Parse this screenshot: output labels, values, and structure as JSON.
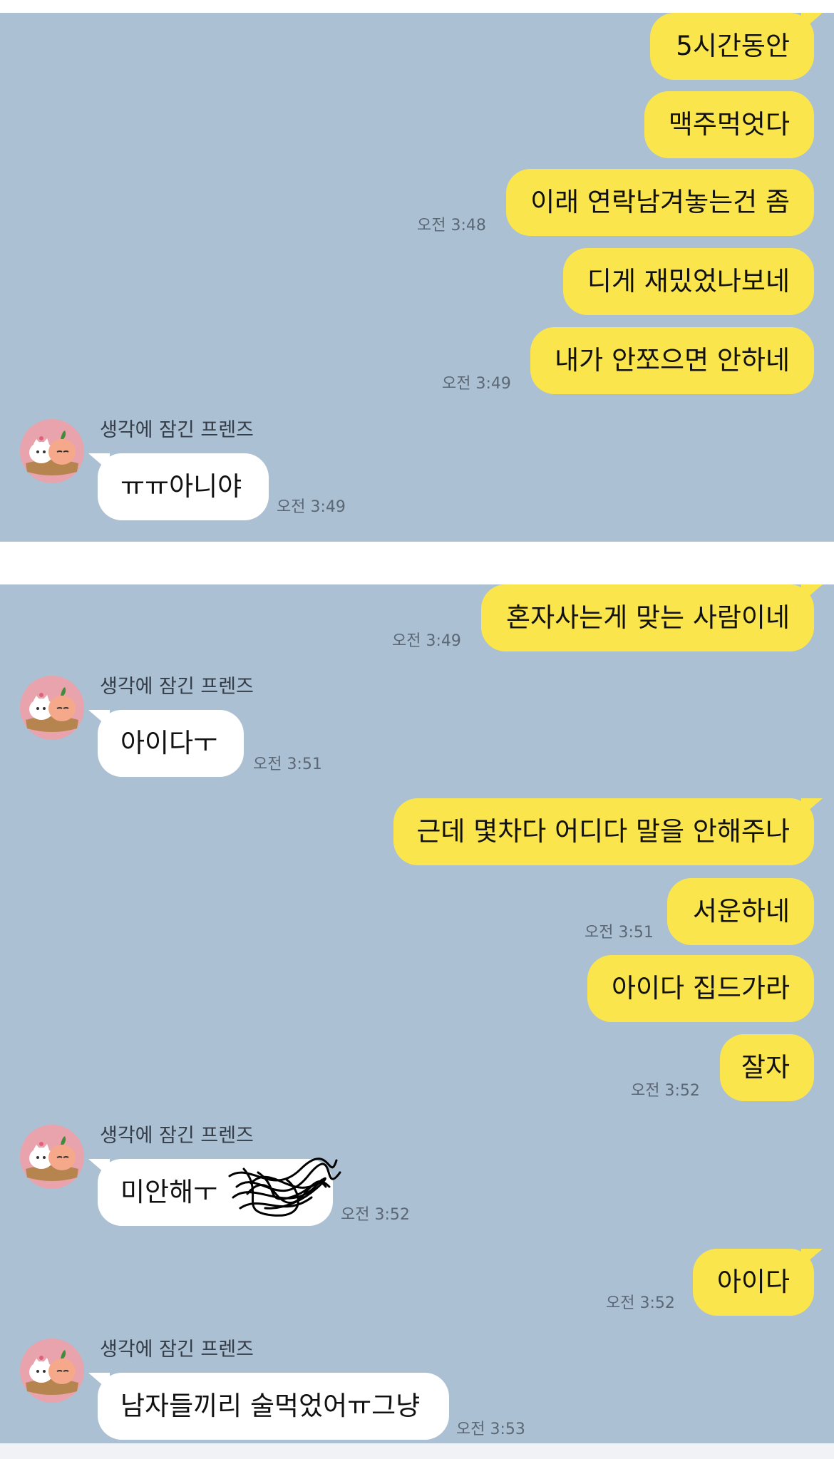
{
  "colors": {
    "background": "#abc0d2",
    "outgoing_bubble": "#fbe54d",
    "incoming_bubble": "#ffffff",
    "time_text": "#5b6775"
  },
  "contact": {
    "name": "생각에 잠긴 프렌즈",
    "avatar_icon": "friends-character-avatar-icon"
  },
  "screen1": {
    "messages": [
      {
        "from": "me",
        "text": "5시간동안"
      },
      {
        "from": "me",
        "text": "맥주먹엇다"
      },
      {
        "from": "me",
        "text": "이래 연락남겨놓는건 좀",
        "time": "오전 3:48"
      },
      {
        "from": "me",
        "text": "디게 재밌었나보네"
      },
      {
        "from": "me",
        "text": "내가 안쪼으면 안하네",
        "time": "오전 3:49"
      },
      {
        "from": "them",
        "sender": "생각에 잠긴 프렌즈",
        "text": "ㅠㅠ아니야",
        "time": "오전 3:49"
      }
    ]
  },
  "screen2": {
    "messages": [
      {
        "from": "me",
        "text": "혼자사는게 맞는 사람이네",
        "time": "오전 3:49"
      },
      {
        "from": "them",
        "sender": "생각에 잠긴 프렌즈",
        "text": "아이다ㅜ",
        "time": "오전 3:51"
      },
      {
        "from": "me",
        "text": "근데 몇차다 어디다 말을 안해주나"
      },
      {
        "from": "me",
        "text": "서운하네",
        "time": "오전 3:51"
      },
      {
        "from": "me",
        "text": "아이다 집드가라"
      },
      {
        "from": "me",
        "text": "잘자",
        "time": "오전 3:52"
      },
      {
        "from": "them",
        "sender": "생각에 잠긴 프렌즈",
        "text": "미안해ㅜ",
        "time": "오전 3:52",
        "redaction_icon": "scribble-redaction-icon"
      },
      {
        "from": "me",
        "text": "아이다",
        "time": "오전 3:52"
      },
      {
        "from": "them",
        "sender": "생각에 잠긴 프렌즈",
        "text": "남자들끼리 술먹었어ㅠ그냥",
        "time": "오전 3:53"
      }
    ]
  }
}
